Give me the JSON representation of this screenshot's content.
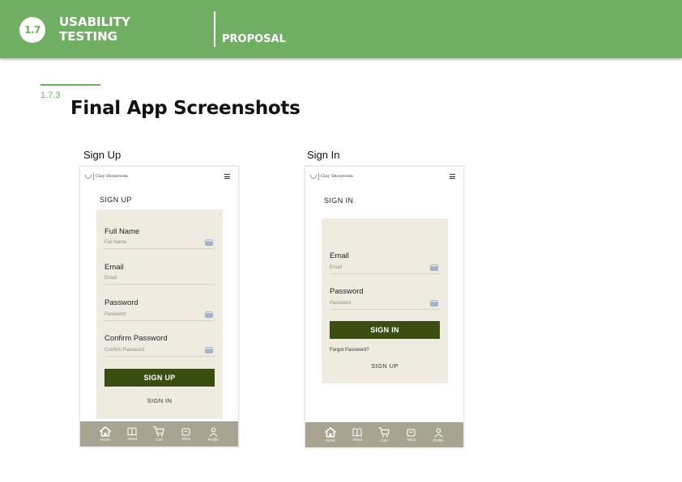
{
  "header": {
    "section_number": "1.7",
    "section_title": "USABILITY TESTING",
    "document_type": "PROPOSAL"
  },
  "page": {
    "subsection_number": "1.7.3",
    "title": "Final App Screenshots"
  },
  "shared": {
    "brand_name": "Clay Showroom",
    "nav_items": [
      {
        "label": "Home",
        "icon": "home-icon"
      },
      {
        "label": "About",
        "icon": "book-icon"
      },
      {
        "label": "Cart",
        "icon": "cart-icon"
      },
      {
        "label": "Shop",
        "icon": "bag-icon"
      },
      {
        "label": "Profile",
        "icon": "profile-icon"
      }
    ],
    "password_key_icon": "••••"
  },
  "signup": {
    "caption": "Sign Up",
    "heading": "SIGN UP",
    "fields": [
      {
        "label": "Full Name",
        "placeholder": "Full Name"
      },
      {
        "label": "Email",
        "placeholder": "Email"
      },
      {
        "label": "Password",
        "placeholder": "Password"
      },
      {
        "label": "Confirm Password",
        "placeholder": "Confirm Password"
      }
    ],
    "primary_button": "SIGN UP",
    "secondary_link": "SIGN IN"
  },
  "signin": {
    "caption": "Sign In",
    "heading": "SIGN IN",
    "fields": [
      {
        "label": "Email",
        "placeholder": "Email"
      },
      {
        "label": "Password",
        "placeholder": "Password"
      }
    ],
    "primary_button": "SIGN IN",
    "forgot_link": "Forgot Password?",
    "secondary_link": "SIGN UP"
  },
  "colors": {
    "header_green": "#70ae63",
    "button_dark_green": "#3b4e12",
    "card_beige": "#efebe1",
    "nav_taupe": "#a9a391"
  }
}
